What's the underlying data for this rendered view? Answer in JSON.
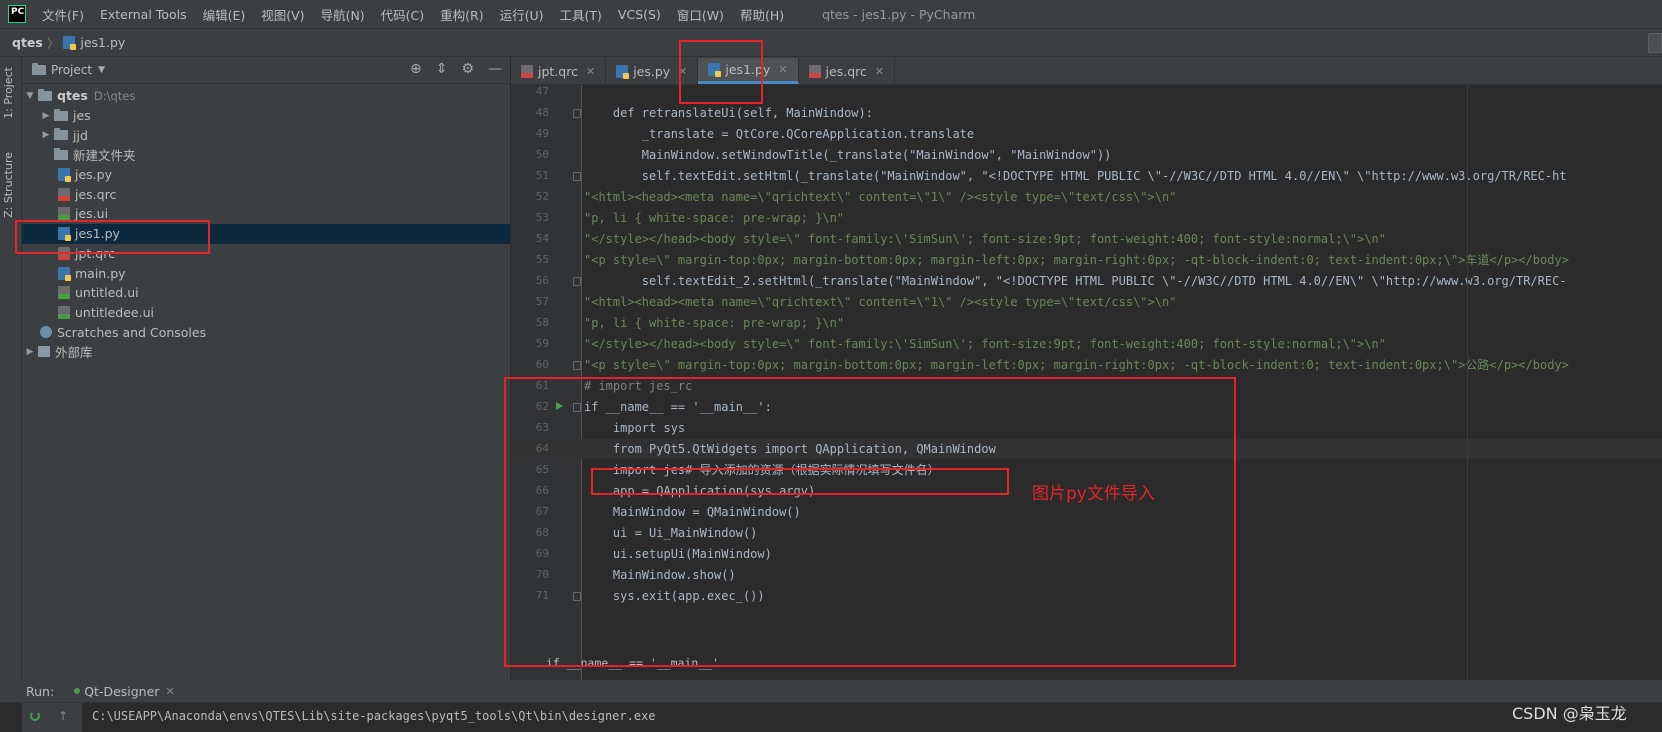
{
  "menubar": {
    "logo": "PC",
    "items": [
      "文件(F)",
      "External Tools",
      "编辑(E)",
      "视图(V)",
      "导航(N)",
      "代码(C)",
      "重构(R)",
      "运行(U)",
      "工具(T)",
      "VCS(S)",
      "窗口(W)",
      "帮助(H)"
    ],
    "title": "qtes - jes1.py - PyCharm"
  },
  "breadcrumb": {
    "project": "qtes",
    "file": "jes1.py"
  },
  "side_tabs": {
    "project": "1: Project",
    "structure": "Z: Structure"
  },
  "project_panel": {
    "title": "Project",
    "root": {
      "name": "qtes",
      "path": "D:\\qtes"
    },
    "items": [
      {
        "label": "jes",
        "kind": "folder",
        "expandable": true
      },
      {
        "label": "jjd",
        "kind": "folder",
        "expandable": true
      },
      {
        "label": "新建文件夹",
        "kind": "folder",
        "expandable": false
      },
      {
        "label": "jes.py",
        "kind": "py"
      },
      {
        "label": "jes.qrc",
        "kind": "qrc"
      },
      {
        "label": "jes.ui",
        "kind": "ui"
      },
      {
        "label": "jes1.py",
        "kind": "py",
        "selected": true
      },
      {
        "label": "jpt.qrc",
        "kind": "qrc"
      },
      {
        "label": "main.py",
        "kind": "py"
      },
      {
        "label": "untitled.ui",
        "kind": "ui"
      },
      {
        "label": "untitledee.ui",
        "kind": "ui"
      }
    ],
    "scratches": "Scratches and Consoles",
    "external_libs": "外部库"
  },
  "editor": {
    "tabs": [
      {
        "label": "jpt.qrc",
        "kind": "qrc"
      },
      {
        "label": "jes.py",
        "kind": "py"
      },
      {
        "label": "jes1.py",
        "kind": "py",
        "active": true
      },
      {
        "label": "jes.qrc",
        "kind": "qrc"
      }
    ],
    "lines": [
      {
        "n": "47",
        "text": ""
      },
      {
        "n": "48",
        "text": "    def retranslateUi(self, MainWindow):"
      },
      {
        "n": "49",
        "text": "        _translate = QtCore.QCoreApplication.translate"
      },
      {
        "n": "50",
        "text": "        MainWindow.setWindowTitle(_translate(\"MainWindow\", \"MainWindow\"))"
      },
      {
        "n": "51",
        "text": "        self.textEdit.setHtml(_translate(\"MainWindow\", \"<!DOCTYPE HTML PUBLIC \\\"-//W3C//DTD HTML 4.0//EN\\\" \\\"http://www.w3.org/TR/REC-ht"
      },
      {
        "n": "52",
        "text": "\"<html><head><meta name=\\\"qrichtext\\\" content=\\\"1\\\" /><style type=\\\"text/css\\\">\\n\""
      },
      {
        "n": "53",
        "text": "\"p, li { white-space: pre-wrap; }\\n\""
      },
      {
        "n": "54",
        "text": "\"</style></head><body style=\\\" font-family:\\'SimSun\\'; font-size:9pt; font-weight:400; font-style:normal;\\\">\\n\""
      },
      {
        "n": "55",
        "text": "\"<p style=\\\" margin-top:0px; margin-bottom:0px; margin-left:0px; margin-right:0px; -qt-block-indent:0; text-indent:0px;\\\">车道</p></body>"
      },
      {
        "n": "56",
        "text": "        self.textEdit_2.setHtml(_translate(\"MainWindow\", \"<!DOCTYPE HTML PUBLIC \\\"-//W3C//DTD HTML 4.0//EN\\\" \\\"http://www.w3.org/TR/REC-"
      },
      {
        "n": "57",
        "text": "\"<html><head><meta name=\\\"qrichtext\\\" content=\\\"1\\\" /><style type=\\\"text/css\\\">\\n\""
      },
      {
        "n": "58",
        "text": "\"p, li { white-space: pre-wrap; }\\n\""
      },
      {
        "n": "59",
        "text": "\"</style></head><body style=\\\" font-family:\\'SimSun\\'; font-size:9pt; font-weight:400; font-style:normal;\\\">\\n\""
      },
      {
        "n": "60",
        "text": "\"<p style=\\\" margin-top:0px; margin-bottom:0px; margin-left:0px; margin-right:0px; -qt-block-indent:0; text-indent:0px;\\\">公路</p></body>"
      },
      {
        "n": "61",
        "text": "# import jes_rc"
      },
      {
        "n": "62",
        "text": "if __name__ == '__main__':"
      },
      {
        "n": "63",
        "text": "    import sys"
      },
      {
        "n": "64",
        "text": "    from PyQt5.QtWidgets import QApplication, QMainWindow"
      },
      {
        "n": "65",
        "text": "    import jes# 导入添加的资源（根据实际情况填写文件名）"
      },
      {
        "n": "66",
        "text": "    app = QApplication(sys.argv)"
      },
      {
        "n": "67",
        "text": "    MainWindow = QMainWindow()"
      },
      {
        "n": "68",
        "text": "    ui = Ui_MainWindow()"
      },
      {
        "n": "69",
        "text": "    ui.setupUi(MainWindow)"
      },
      {
        "n": "70",
        "text": "    MainWindow.show()"
      },
      {
        "n": "71",
        "text": "    sys.exit(app.exec_())"
      }
    ],
    "breadcrumb_hint": "if __name__ == '__main__'"
  },
  "run_panel": {
    "label": "Run:",
    "tab": "Qt-Designer",
    "console_line": "C:\\USEAPP\\Anaconda\\envs\\QTES\\Lib\\site-packages\\pyqt5_tools\\Qt\\bin\\designer.exe"
  },
  "annotation": {
    "text": "图片py文件导入",
    "color": "#e3242b"
  },
  "watermark": "CSDN @枭玉龙"
}
